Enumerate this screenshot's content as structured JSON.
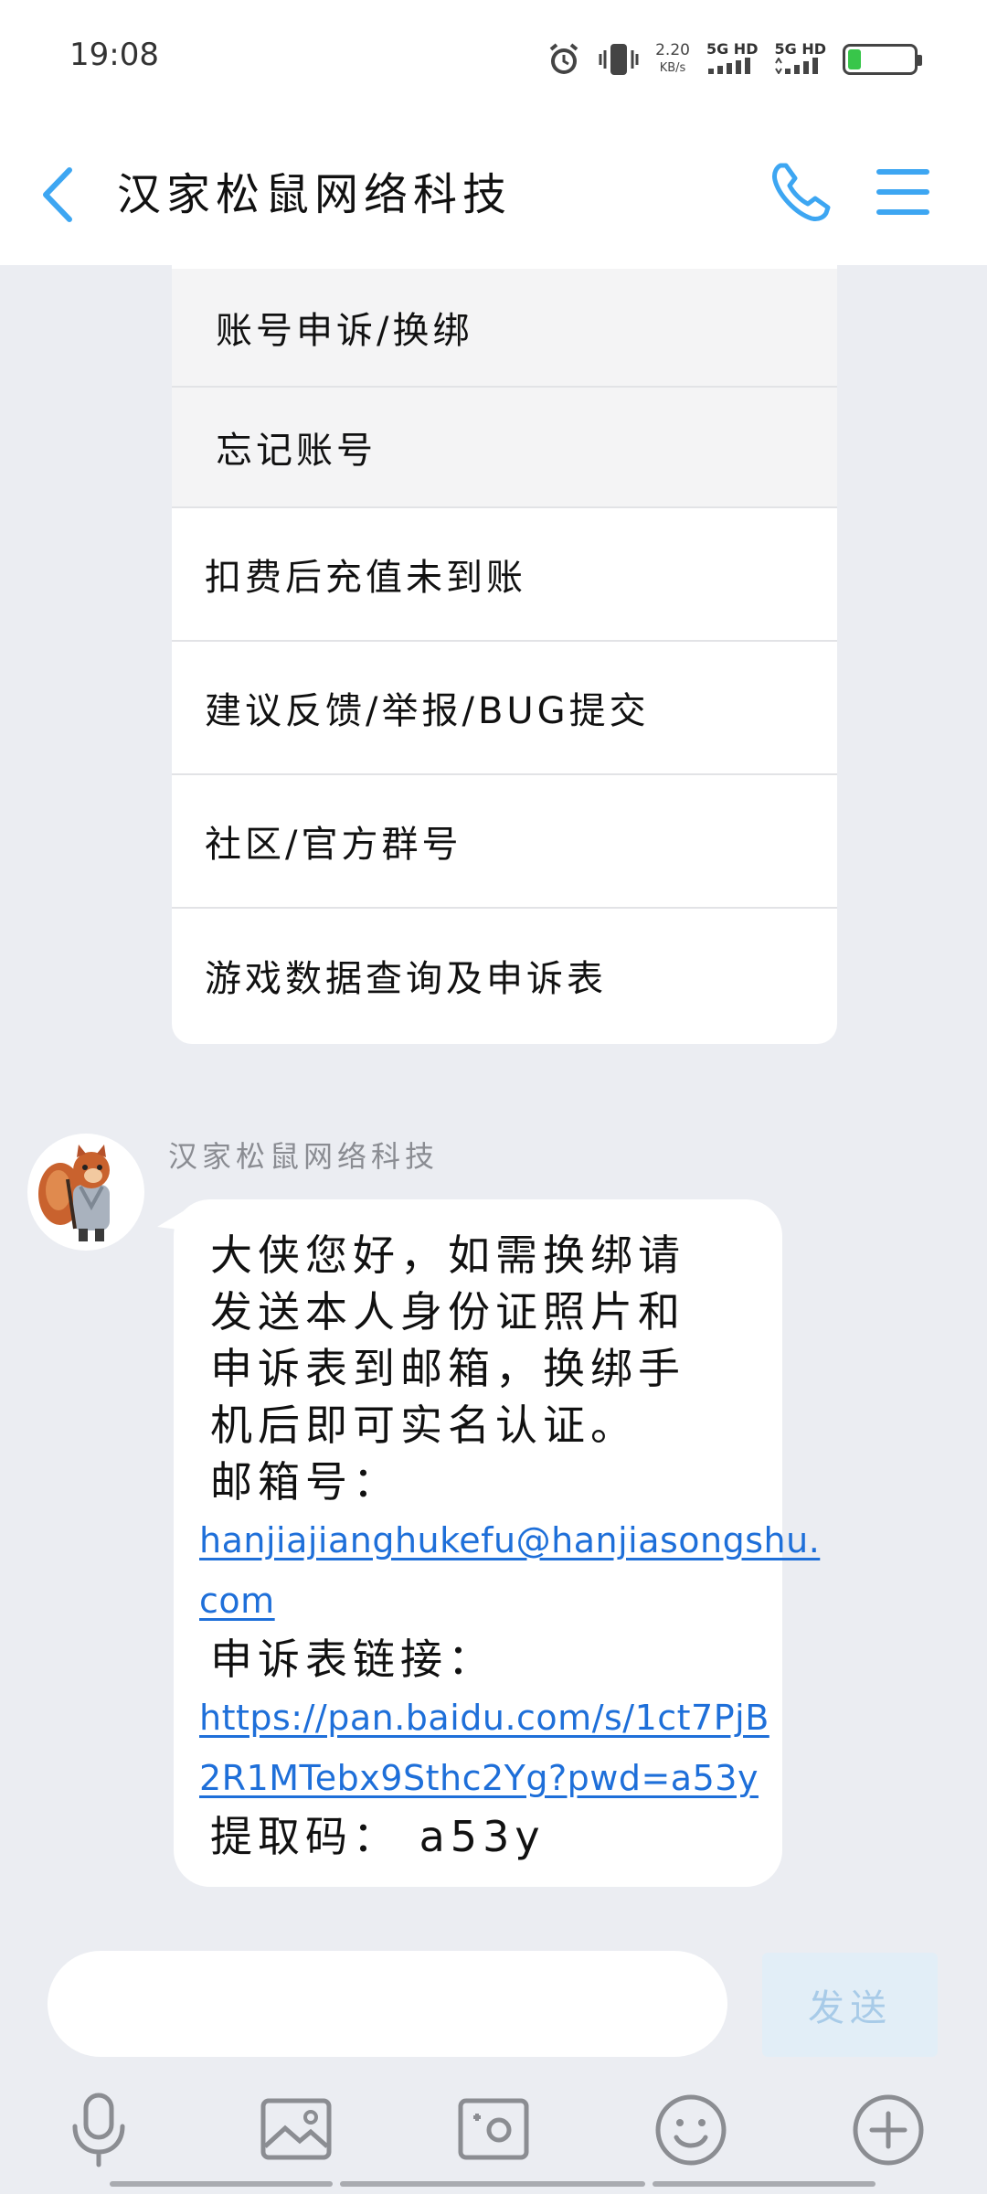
{
  "status_bar": {
    "time": "19:08",
    "net_speed_value": "2.20",
    "net_speed_unit": "KB/s",
    "sim1": "5G HD",
    "sim2": "5G HD",
    "battery_level": 0.2
  },
  "header": {
    "title": "汉家松鼠网络科技"
  },
  "menu": {
    "items": [
      {
        "label": "账号申诉/换绑"
      },
      {
        "label": "忘记账号"
      },
      {
        "label": "扣费后充值未到账"
      },
      {
        "label": "建议反馈/举报/BUG提交"
      },
      {
        "label": "社区/官方群号"
      },
      {
        "label": "游戏数据查询及申诉表"
      }
    ]
  },
  "message": {
    "sender": "汉家松鼠网络科技",
    "lines": [
      "大侠您好，如需换绑请",
      "发送本人身份证照片和",
      "申诉表到邮箱，换绑手",
      "机后即可实名认证。",
      "邮箱号："
    ],
    "email_line1": "hanjiajianghukefu@hanjiasongshu.",
    "email_line2": "com",
    "form_label": "申诉表链接：",
    "link_line1": "https://pan.baidu.com/s/1ct7PjB",
    "link_line2": "2R1MTebx9Sthc2Yg?pwd=a53y",
    "code_line": "提取码： a53y"
  },
  "composer": {
    "input_value": "",
    "send_label": "发送"
  },
  "toolbar": {
    "icons": [
      "microphone-icon",
      "image-icon",
      "camera-icon",
      "emoji-icon",
      "plus-icon"
    ]
  },
  "colors": {
    "accent": "#3DA6F2",
    "link": "#1E6FD9",
    "background": "#EBEDF2"
  }
}
